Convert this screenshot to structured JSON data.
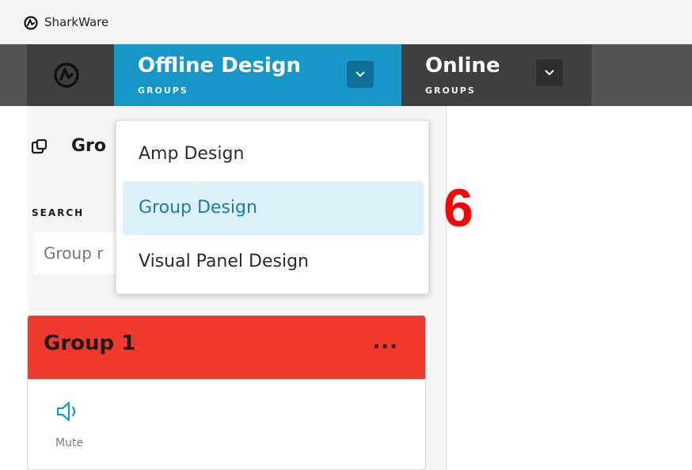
{
  "window": {
    "title": "SharkWare",
    "icon": "sharkware-logo-icon"
  },
  "nav": {
    "home_icon": "sharkware-logo-icon",
    "tabs": [
      {
        "title": "Offline Design",
        "subtitle": "GROUPS",
        "active": true,
        "dropdown_icon": "chevron-down-icon"
      },
      {
        "title": "Online",
        "subtitle": "GROUPS",
        "active": false,
        "dropdown_icon": "chevron-down-icon"
      }
    ]
  },
  "sidebar": {
    "heading": "Gro",
    "heading_icon": "groups-icon",
    "search_label": "SEARCH",
    "search_placeholder": "Group r"
  },
  "group_card": {
    "title": "Group 1",
    "menu": "...",
    "action_label": "Mute",
    "action_icon": "speaker-icon",
    "header_color": "#f03a2d"
  },
  "dropdown": {
    "items": [
      {
        "label": "Amp Design",
        "selected": false
      },
      {
        "label": "Group Design",
        "selected": true
      },
      {
        "label": "Visual Panel Design",
        "selected": false
      }
    ]
  },
  "annotation": {
    "step_number": "6",
    "color": "#ff0000"
  },
  "colors": {
    "accent": "#1796c8",
    "nav_bg": "#545454",
    "nav_dark": "#3f3f3f"
  }
}
